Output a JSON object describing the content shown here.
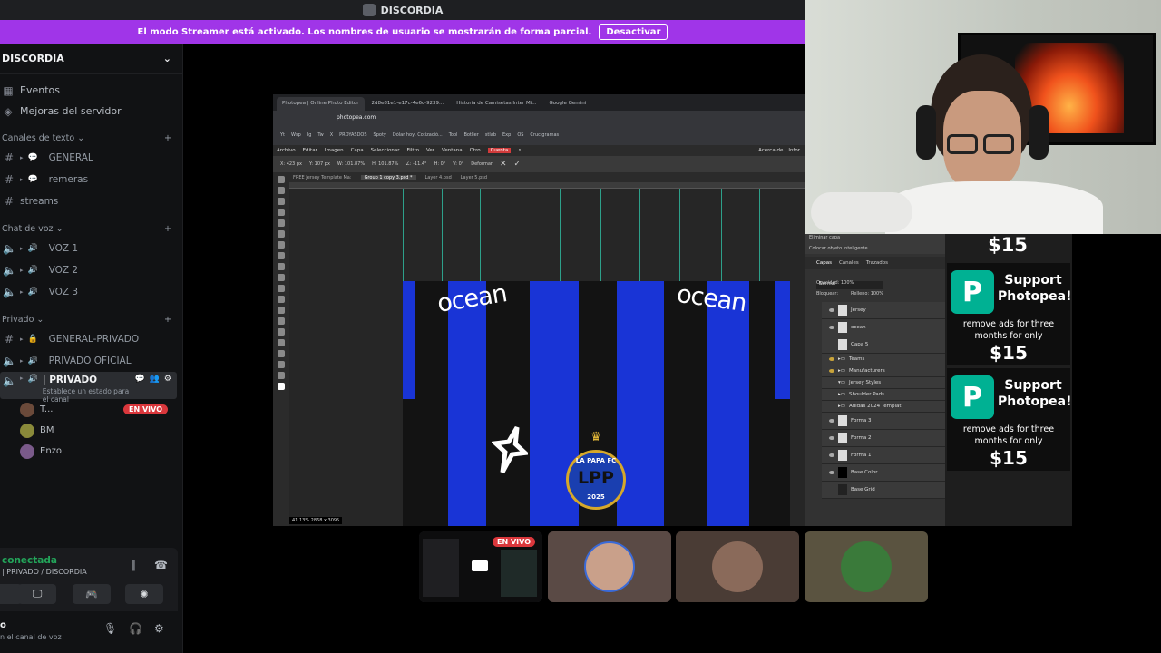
{
  "titlebar": {
    "title": "DISCORDIA"
  },
  "banner": {
    "text": "El modo Streamer está activado. Los nombres de usuario se mostrarán de forma parcial.",
    "button": "Desactivar"
  },
  "sidebar": {
    "server_name": "DISCORDIA",
    "top_items": [
      {
        "label": "Eventos",
        "icon": "calendar-icon"
      },
      {
        "label": "Mejoras del servidor",
        "icon": "boost-icon"
      }
    ],
    "categories": [
      {
        "name": "Canales de texto",
        "channels": [
          {
            "label": "| GENERAL",
            "icon": "hash-icon"
          },
          {
            "label": "| remeras",
            "icon": "hash-icon"
          },
          {
            "label": "streams",
            "icon": "hash-icon"
          }
        ]
      },
      {
        "name": "Chat de voz",
        "channels": [
          {
            "label": "| VOZ 1",
            "icon": "speaker-icon"
          },
          {
            "label": "| VOZ 2",
            "icon": "speaker-icon"
          },
          {
            "label": "| VOZ 3",
            "icon": "speaker-icon"
          }
        ]
      },
      {
        "name": "Privado",
        "channels": [
          {
            "label": "| GENERAL-PRIVADO",
            "icon": "hash-icon"
          },
          {
            "label": "| PRIVADO OFICIAL",
            "icon": "speaker-icon"
          }
        ]
      }
    ],
    "active_channel": {
      "label": "| PRIVADO",
      "status": "Establece un estado para el canal"
    },
    "voice_users": [
      {
        "name": "T...",
        "badge": "EN VIVO",
        "avatar_color": "#6b4a3a"
      },
      {
        "name": "BM",
        "avatar_color": "#8a8a3a"
      },
      {
        "name": "Enzo",
        "avatar_color": "#7a5a8a"
      }
    ],
    "voice_panel": {
      "status": "conectada",
      "sub": "| PRIVADO / DISCORDIA"
    },
    "user_panel": {
      "name": "o",
      "sub": "n el canal de voz"
    }
  },
  "stream": {
    "browser_tabs": [
      "Photopea | Online Photo Editor",
      "2d8e81e1-e17c-4e6c-9239...",
      "Historia de Camisetas Inter Mi...",
      "Google Gemini"
    ],
    "address": "photopea.com",
    "bookmarks": [
      "Yt",
      "Wsp",
      "Ig",
      "Tw",
      "X",
      "PROYASDOS",
      "Spoty",
      "Dólar hoy, Cotizació...",
      "Tool",
      "Botlier",
      "stlab",
      "Exp",
      "OS",
      "Crucigramas"
    ],
    "menu": [
      "Archivo",
      "Editar",
      "Imagen",
      "Capa",
      "Seleccionar",
      "Filtro",
      "Ver",
      "Ventana",
      "Otro",
      "Cuenta"
    ],
    "menu_right": [
      "Acerca de",
      "Infor"
    ],
    "options": [
      "X: 423 px",
      "Y: 107 px",
      "W: 101.87%",
      "H: 101.87%",
      "∠: -11.4°",
      "H: 0°",
      "V: 0°",
      "Deformar"
    ],
    "doc_tabs": [
      "FREE Jersey Template Ma:",
      "Group 1 copy 3.psd *",
      "Layer 4.psd",
      "Layer 5.psd"
    ],
    "jersey_text": [
      "ocean",
      "ocean"
    ],
    "crest": {
      "top": "LA PAPA FC",
      "letters": "LPP",
      "year": "2025"
    },
    "status": "41.13%   2868 x 3095",
    "panel": {
      "top": [
        "Eliminar capa",
        "Colocar objeto inteligente"
      ],
      "tabs": [
        "Capas",
        "Canales",
        "Trazados"
      ],
      "blend": "Normal",
      "opacity": "Opacidad: 100%",
      "lock": "Bloquear:",
      "fill": "Relleno: 100%",
      "layers": [
        "Jersey",
        "ocean",
        "Capa 5",
        "Teams",
        "Manufacturers",
        "Jersey Styles",
        "Shoulder Pads",
        "Adidas 2024 Templat",
        "Forma 3",
        "Forma 2",
        "Forma 1",
        "Base Color",
        "Base Grid"
      ]
    },
    "ads": {
      "price_top": "$15",
      "title": "Support Photopea!",
      "text": "remove ads for three months for only",
      "price": "$15"
    }
  },
  "tiles": [
    {
      "badge": "EN VIVO",
      "bg": "#2b2d31"
    },
    {
      "bg": "#5a4a45",
      "avatar_color": "#c9a08a"
    },
    {
      "bg": "#4a3c35",
      "avatar_color": "#8a6a5a"
    },
    {
      "bg": "#5a5340",
      "avatar_color": "#3a7a3a"
    }
  ],
  "colors": {
    "banner": "#a035e8",
    "live": "#da373c",
    "connected": "#23a55a",
    "photopea_teal": "#00b193",
    "jersey_blue": "#1934d6"
  }
}
